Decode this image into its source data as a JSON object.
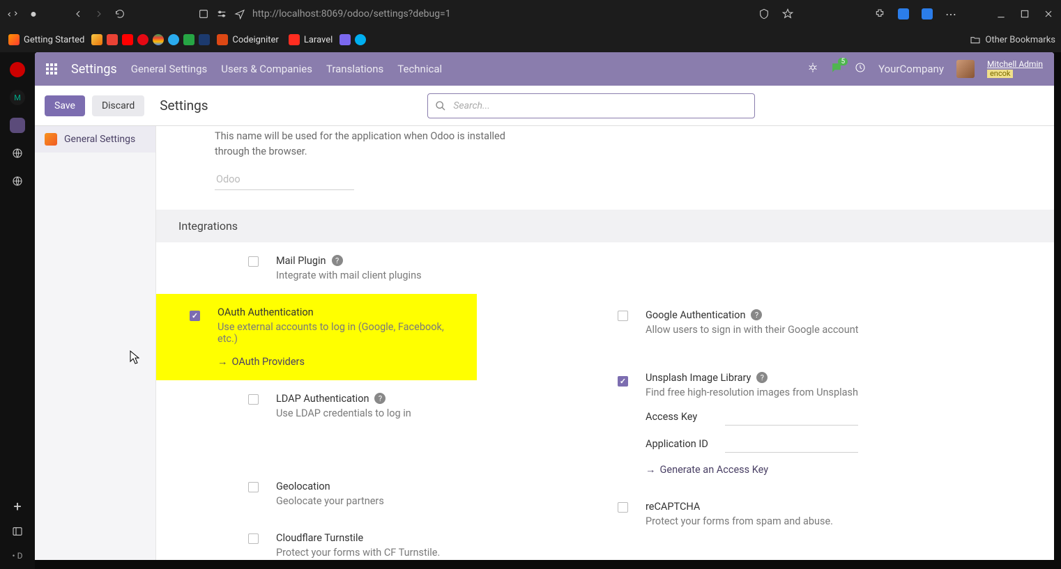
{
  "browser": {
    "url_display": "http://localhost:8069/odoo/settings?debug=1",
    "bookmarks": {
      "getting_started": "Getting Started",
      "codeigniter": "Codeigniter",
      "laravel": "Laravel",
      "other": "Other Bookmarks"
    }
  },
  "firefox_sidebar": {
    "bottom_label": "D"
  },
  "nav": {
    "app_title": "Settings",
    "links": [
      "General Settings",
      "Users & Companies",
      "Translations",
      "Technical"
    ],
    "chat_count": "5",
    "company": "YourCompany",
    "user_name": "Mitchell Admin",
    "db_name": "encok"
  },
  "actionbar": {
    "save": "Save",
    "discard": "Discard",
    "breadcrumb": "Settings",
    "search_placeholder": "Search..."
  },
  "sidebar": {
    "general_settings": "General Settings"
  },
  "top_block": {
    "helper": "This name will be used for the application when Odoo is installed through the browser.",
    "app_name_value": "Odoo"
  },
  "section": {
    "integrations": "Integrations"
  },
  "settings": {
    "mail_plugin": {
      "title": "Mail Plugin",
      "desc": "Integrate with mail client plugins"
    },
    "oauth": {
      "title": "OAuth Authentication",
      "desc": "Use external accounts to log in (Google, Facebook, etc.)",
      "providers_link": "OAuth Providers"
    },
    "google_auth": {
      "title": "Google Authentication",
      "desc": "Allow users to sign in with their Google account"
    },
    "ldap": {
      "title": "LDAP Authentication",
      "desc": "Use LDAP credentials to log in"
    },
    "unsplash": {
      "title": "Unsplash Image Library",
      "desc": "Find free high-resolution images from Unsplash",
      "access_key_label": "Access Key",
      "app_id_label": "Application ID",
      "generate_link": "Generate an Access Key"
    },
    "geolocation": {
      "title": "Geolocation",
      "desc": "Geolocate your partners"
    },
    "recaptcha": {
      "title": "reCAPTCHA",
      "desc": "Protect your forms from spam and abuse."
    },
    "turnstile": {
      "title": "Cloudflare Turnstile",
      "desc": "Protect your forms with CF Turnstile."
    }
  }
}
